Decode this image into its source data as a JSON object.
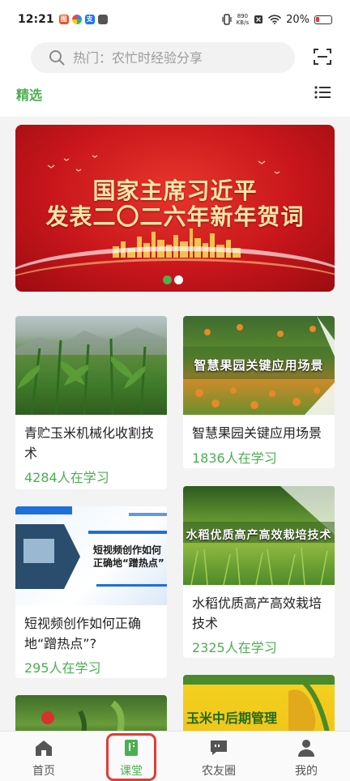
{
  "status_bar": {
    "time": "12:21",
    "net_speed_value": "890",
    "net_speed_unit": "KB/s",
    "battery": "20%"
  },
  "search": {
    "placeholder": "热门：农忙时经验分享"
  },
  "tabs": {
    "featured": "精选"
  },
  "banner": {
    "line1": "国家主席习近平",
    "line2": "发表二〇二六年新年贺词",
    "slide_count": 2,
    "active_slide": 1
  },
  "courses": [
    {
      "title": "青贮玉米机械化收割技术",
      "learners": "4284人在学习"
    },
    {
      "title": "智慧果园关键应用场景",
      "learners": "1836人在学习",
      "image_text": "智慧果园关键应用场景"
    },
    {
      "title": "短视频创作如何正确地“蹭热点”?",
      "learners": "295人在学习",
      "image_text_1": "短视频创作如何",
      "image_text_2": "正确地“蹭热点”"
    },
    {
      "title": "水稻优质高产高效栽培技术",
      "learners": "2325人在学习",
      "image_text": "水稻优质高产高效栽培技术"
    },
    {
      "title": "",
      "learners": ""
    },
    {
      "title": "",
      "learners": "",
      "image_text": "玉米中后期管理"
    }
  ],
  "nav": {
    "home": "首页",
    "classroom": "课堂",
    "circle": "农友圈",
    "mine": "我的",
    "active": "classroom"
  },
  "colors": {
    "accent_green": "#4caf50",
    "banner_red": "#c8161c",
    "highlight_red": "#e53935"
  }
}
